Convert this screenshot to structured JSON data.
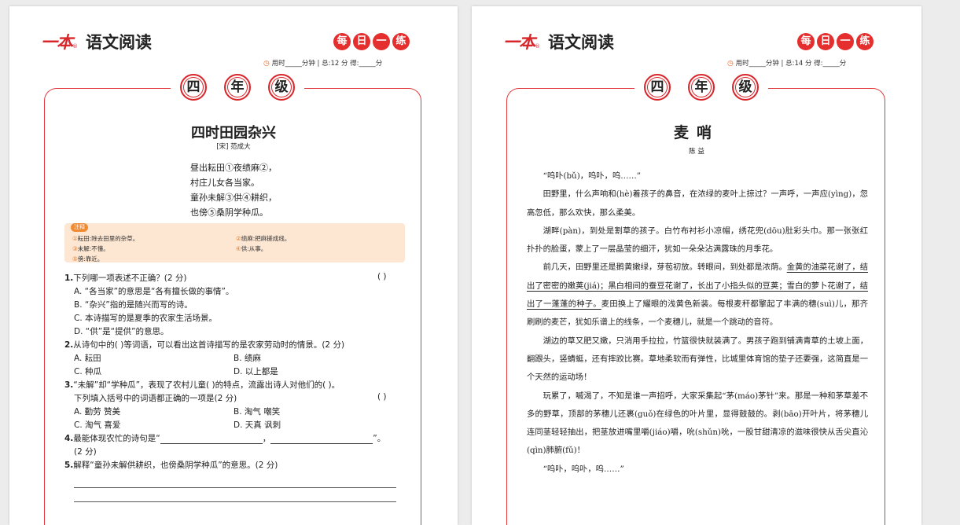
{
  "left": {
    "brand": {
      "logo": "一本",
      "reg": "®",
      "title": "语文阅读"
    },
    "daily": [
      "每",
      "日",
      "一",
      "练"
    ],
    "timing": {
      "clock": "◷",
      "text": "用时_____分钟 | 总:12 分   得:_____分"
    },
    "grade": [
      "四",
      "年",
      "级"
    ],
    "title": "四时田园杂兴",
    "author": "[宋] 范成大",
    "poem": [
      "昼出耘田①夜绩麻②，",
      "村庄儿女各当家。",
      "童孙未解③供④耕织，",
      "也傍⑤桑阴学种瓜。"
    ],
    "notes_tag": "注释",
    "notes": [
      {
        "num": "①",
        "text": "耘田:除去田里的杂草。"
      },
      {
        "num": "②",
        "text": "绩麻:把麻搓成线。"
      },
      {
        "num": "③",
        "text": "未解:不懂。"
      },
      {
        "num": "④",
        "text": "供:从事。"
      },
      {
        "num": "⑤",
        "text": "傍:靠近。"
      }
    ],
    "questions": {
      "q1": {
        "num": "1.",
        "text": "下列哪一项表述不正确？(2 分)",
        "paren": "(        )"
      },
      "q1a": "A. “各当家”的意思是“各有擅长做的事情”。",
      "q1b": "B. “杂兴”指的是随兴而写的诗。",
      "q1c": "C. 本诗描写的是夏季的农家生活场景。",
      "q1d": "D. “供”是“提供”的意思。",
      "q2": {
        "num": "2.",
        "text": "从诗句中的(        )等词语，可以看出这首诗描写的是农家劳动时的情景。(2 分)"
      },
      "q2a": "A. 耘田",
      "q2b": "B. 绩麻",
      "q2c": "C. 种瓜",
      "q2d": "D. 以上都是",
      "q3": {
        "num": "3.",
        "text": "“未解”却“学种瓜”，表现了农村儿童(        )的特点，流露出诗人对他们的(        )。"
      },
      "q3b": "下列填入括号中的词语都正确的一项是(2 分)",
      "q3paren": "(        )",
      "q3A": "A. 勤劳    赞美",
      "q3B": "B. 淘气    嘲笑",
      "q3C": "C. 淘气    喜爱",
      "q3D": "D. 天真    讽刺",
      "q4": {
        "num": "4.",
        "text": "最能体现农忙的诗句是“",
        "sep": "，",
        "end": "”。"
      },
      "q4b": "(2 分)",
      "q5": {
        "num": "5.",
        "text": "解释“童孙未解供耕织，也傍桑阴学种瓜”的意思。(2 分)"
      }
    }
  },
  "right": {
    "brand": {
      "logo": "一本",
      "reg": "®",
      "title": "语文阅读"
    },
    "daily": [
      "每",
      "日",
      "一",
      "练"
    ],
    "timing": {
      "clock": "◷",
      "text": "用时_____分钟 | 总:14 分   得:_____分"
    },
    "grade": [
      "四",
      "年",
      "级"
    ],
    "title": "麦哨",
    "author": "陈  益",
    "p1": "“呜卟(bǔ)，呜卟，呜……”",
    "p2": "田野里，什么声响和(hè)着孩子的鼻音，在浓绿的麦叶上掠过？一声呼，一声应(yìng)，忽高忽低，那么欢快，那么柔美。",
    "p3": "湖畔(pàn)，到处是割草的孩子。白竹布衬衫小凉帽，绣花兜(dōu)肚彩头巾。那一张张红扑扑的脸蛋，蒙上了一层晶莹的细汗，犹如一朵朵沾满露珠的月季花。",
    "p4a": "前几天，田野里还是鹅黄嫩绿，芽苞初放。转眼间，到处都是浓荫。",
    "p4u": "金黄的油菜花谢了，结出了密密的嫩荚(jiá)；黑白相间的蚕豆花谢了，长出了小指头似的豆荚；雪白的萝卜花谢了，结出了一蓬蓬的种子。",
    "p4b": "麦田换上了耀眼的浅黄色新装。每根麦秆都擎起了丰满的穗(suì)儿，那齐刷刷的麦芒，犹如乐谱上的线条，一个麦穗儿，就是一个跳动的音符。",
    "p5": "湖边的草又肥又嫩，只消用手拉拉，竹篮很快就装满了。男孩子跑到铺满青草的土坡上面，翻跟头，竖蜻蜓，还有摔跤比赛。草地柔软而有弹性，比城里体育馆的垫子还要强，这简直是一个天然的运动场！",
    "p6": "玩累了，嘁渴了，不知是谁一声招呼，大家采集起“茅(máo)茅针”来。那是一种和茅草差不多的野草，顶部的茅穗儿还裹(guǒ)在绿色的叶片里，显得鼓鼓的。剥(bāo)开叶片，将茅穗儿连同茎轻轻抽出，把茎放进嘴里嚼(jiáo)嚼，吮(shǔn)吮，一股甘甜清凉的滋味很快从舌尖直沁(qìn)肺腑(fǔ)！",
    "p7": "“呜卟，呜卟，呜……”"
  }
}
